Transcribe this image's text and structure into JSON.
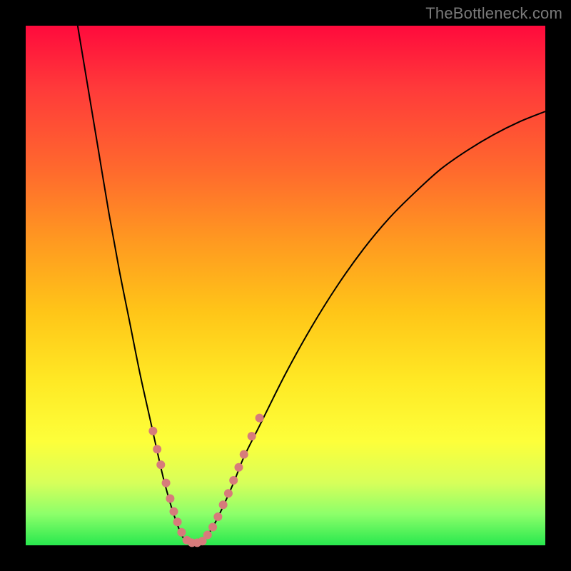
{
  "watermark": "TheBottleneck.com",
  "colors": {
    "frame_bg": "#000000",
    "gradient_top": "#ff0a3c",
    "gradient_bottom": "#28e84e",
    "curve": "#000000",
    "dot_fill": "#d77b7b"
  },
  "chart_data": {
    "type": "line",
    "title": "",
    "xlabel": "",
    "ylabel": "",
    "xlim": [
      0,
      100
    ],
    "ylim": [
      0,
      100
    ],
    "series": [
      {
        "name": "left_curve",
        "x": [
          10.0,
          12.0,
          14.0,
          16.0,
          18.0,
          20.0,
          22.0,
          24.0,
          26.0,
          27.0,
          28.0,
          29.0,
          30.0,
          31.0
        ],
        "y": [
          100.0,
          88.0,
          76.0,
          64.0,
          53.0,
          43.0,
          33.0,
          24.0,
          15.0,
          11.0,
          7.5,
          4.5,
          2.0,
          0.5
        ]
      },
      {
        "name": "valley_flat",
        "x": [
          31.0,
          34.0
        ],
        "y": [
          0.5,
          0.5
        ]
      },
      {
        "name": "right_curve",
        "x": [
          34.0,
          36.0,
          38.0,
          40.0,
          42.0,
          45.0,
          50.0,
          55.0,
          60.0,
          65.0,
          70.0,
          75.0,
          80.0,
          85.0,
          90.0,
          95.0,
          100.0
        ],
        "y": [
          0.5,
          3.5,
          7.5,
          12.0,
          17.0,
          23.0,
          33.0,
          42.0,
          50.0,
          57.0,
          63.0,
          68.0,
          72.5,
          76.0,
          79.0,
          81.5,
          83.5
        ]
      }
    ],
    "markers": [
      {
        "x": 24.5,
        "y": 22.0
      },
      {
        "x": 25.3,
        "y": 18.5
      },
      {
        "x": 26.0,
        "y": 15.5
      },
      {
        "x": 27.0,
        "y": 12.0
      },
      {
        "x": 27.8,
        "y": 9.0
      },
      {
        "x": 28.5,
        "y": 6.5
      },
      {
        "x": 29.2,
        "y": 4.5
      },
      {
        "x": 30.0,
        "y": 2.5
      },
      {
        "x": 31.0,
        "y": 1.0
      },
      {
        "x": 32.0,
        "y": 0.5
      },
      {
        "x": 33.0,
        "y": 0.5
      },
      {
        "x": 34.0,
        "y": 0.8
      },
      {
        "x": 35.0,
        "y": 2.0
      },
      {
        "x": 36.0,
        "y": 3.5
      },
      {
        "x": 37.0,
        "y": 5.5
      },
      {
        "x": 38.0,
        "y": 7.8
      },
      {
        "x": 39.0,
        "y": 10.0
      },
      {
        "x": 40.0,
        "y": 12.5
      },
      {
        "x": 41.0,
        "y": 15.0
      },
      {
        "x": 42.0,
        "y": 17.5
      },
      {
        "x": 43.5,
        "y": 21.0
      },
      {
        "x": 45.0,
        "y": 24.5
      }
    ],
    "marker_radius_px": 6
  }
}
